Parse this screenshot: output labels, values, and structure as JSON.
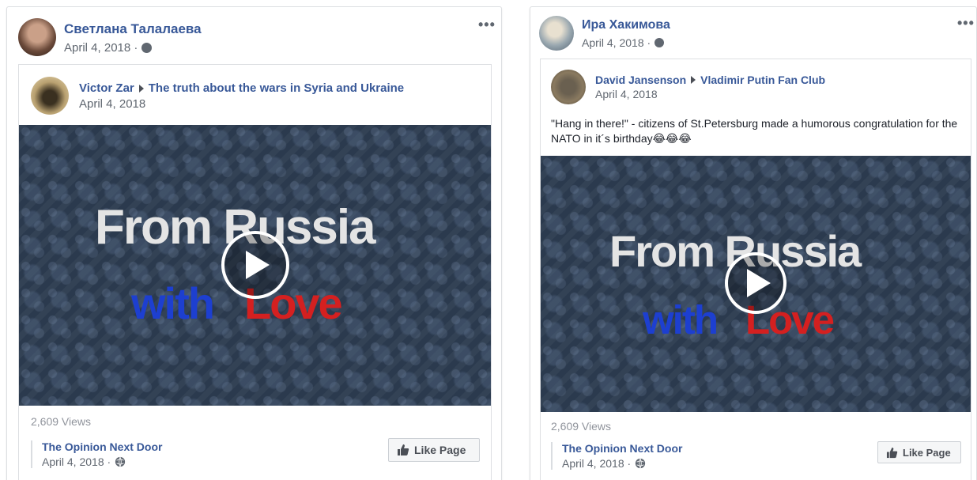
{
  "posts": [
    {
      "author": "Светлана Талалаева",
      "date": "April 4, 2018 ·",
      "more": "•••",
      "shared": {
        "author": "Victor Zar",
        "target": "The truth about the wars in Syria and Ukraine",
        "date": "April 4, 2018",
        "caption": ""
      },
      "video": {
        "line1": "From Russia",
        "with": "with",
        "love": "Love"
      },
      "views": "2,609 Views",
      "page": {
        "name": "The Opinion Next Door",
        "date": "April 4, 2018 ·"
      },
      "like_label": "Like Page"
    },
    {
      "author": "Ира Хакимова",
      "date": "April 4, 2018 ·",
      "more": "•••",
      "shared": {
        "author": "David Jansenson",
        "target": "Vladimir Putin Fan Club",
        "date": "April 4, 2018",
        "caption": "\"Hang in there!\" - citizens of St.Petersburg made a humorous congratulation for the NATO in it´s birthday😂😂😂"
      },
      "video": {
        "line1": "From Russia",
        "with": "with",
        "love": "Love"
      },
      "views": "2,609 Views",
      "page": {
        "name": "The Opinion Next Door",
        "date": "April 4, 2018 ·"
      },
      "like_label": "Like Page"
    }
  ],
  "colors": {
    "link": "#385898",
    "meta": "#606770",
    "border": "#dddfe2",
    "red": "#d42020",
    "blue": "#1d3fd0"
  },
  "icons": [
    "globe-icon",
    "more-icon",
    "arrow-right-icon",
    "play-icon",
    "thumbs-up-icon"
  ]
}
